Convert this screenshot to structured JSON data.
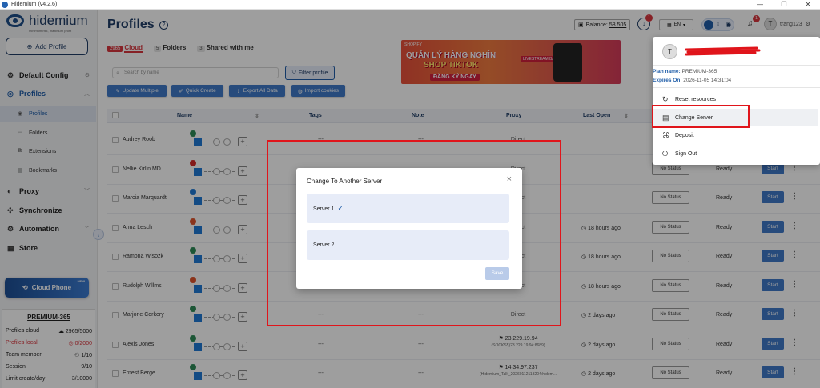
{
  "window": {
    "title": "Hidemium (v4.2.6)",
    "controls": [
      "—",
      "❐",
      "✕"
    ]
  },
  "sidebar": {
    "logo_name": "hidemium",
    "logo_tagline": "minimum risk, maximum profit",
    "add_profile_label": "Add Profile",
    "default_config_label": "Default Config",
    "profiles_label": "Profiles",
    "subitems": [
      {
        "label": "Profiles"
      },
      {
        "label": "Folders"
      },
      {
        "label": "Extensions"
      },
      {
        "label": "Bookmarks"
      }
    ],
    "proxy_label": "Proxy",
    "sync_label": "Synchronize",
    "automation_label": "Automation",
    "store_label": "Store",
    "cloud_phone_label": "Cloud Phone",
    "cloud_phone_badge": "NEW",
    "plan": {
      "title": "PREMIUM-365",
      "rows": [
        {
          "label": "Profiles cloud",
          "value": "2965/5000"
        },
        {
          "label": "Profiles local",
          "value": "0/2000"
        },
        {
          "label": "Team member",
          "value": "1/10"
        },
        {
          "label": "Session",
          "value": "9/10"
        },
        {
          "label": "Limit create/day",
          "value": "3/10000"
        }
      ]
    }
  },
  "header": {
    "title": "Profiles",
    "tabs": [
      {
        "count": "2965",
        "label": "Cloud"
      },
      {
        "count": "5",
        "label": "Folders"
      },
      {
        "count": "3",
        "label": "Shared with me"
      }
    ],
    "search_placeholder": "Search by name",
    "filter_label": "Filter profile",
    "actions": [
      "Update Multiple",
      "Quick Create",
      "Export All Data",
      "Import cookies"
    ],
    "balance_label": "Balance:",
    "balance_value": "58.505",
    "update_badge": "1",
    "lang": "EN",
    "notif_badge": "1",
    "user_name": "trang123",
    "avatar_letter": "T"
  },
  "banner": {
    "brand": "SHOPIFY",
    "line1": "QUẢN LÝ HÀNG NGHÌN",
    "line2": "SHOP TIKTOK",
    "cta": "ĐĂNG KÝ NGAY",
    "tag": "LIVESTREAM BÁN HÀNG"
  },
  "table": {
    "columns": [
      "Name",
      "Tags",
      "Note",
      "Proxy",
      "Last Open"
    ],
    "rows": [
      {
        "name": "Audrey Roob",
        "proxy": "Direct",
        "proxy_sub": "",
        "last_open": "",
        "status": "",
        "ready": "",
        "start": ""
      },
      {
        "name": "Nellie Kirlin MD",
        "proxy": "Direct",
        "proxy_sub": "",
        "last_open": "",
        "status": "No Status",
        "ready": "Ready",
        "start": "Start"
      },
      {
        "name": "Marcia Marquardt",
        "proxy": "Direct",
        "proxy_sub": "",
        "last_open": "",
        "status": "No Status",
        "ready": "Ready",
        "start": "Start"
      },
      {
        "name": "Anna Lesch",
        "proxy": "Direct",
        "proxy_sub": "",
        "last_open": "18 hours ago",
        "status": "No Status",
        "ready": "Ready",
        "start": "Start"
      },
      {
        "name": "Ramona Wisozk",
        "proxy": "Direct",
        "proxy_sub": "",
        "last_open": "18 hours ago",
        "status": "No Status",
        "ready": "Ready",
        "start": "Start"
      },
      {
        "name": "Rudolph Willms",
        "proxy": "Direct",
        "proxy_sub": "",
        "last_open": "18 hours ago",
        "status": "No Status",
        "ready": "Ready",
        "start": "Start"
      },
      {
        "name": "Marjorie Corkery",
        "proxy": "Direct",
        "proxy_sub": "",
        "last_open": "2 days ago",
        "status": "No Status",
        "ready": "Ready",
        "start": "Start"
      },
      {
        "name": "Alexis Jones",
        "proxy": "23.229.19.94",
        "proxy_sub": "(SOCKS5)23.229.19.94:8689)",
        "last_open": "2 days ago",
        "status": "No Status",
        "ready": "Ready",
        "start": "Start"
      },
      {
        "name": "Ernest Berge",
        "proxy": "14.34.97.237",
        "proxy_sub": "(Hidemium_Talk_20260112113204:hidem...",
        "last_open": "2 days ago",
        "status": "No Status",
        "ready": "Ready",
        "start": "Start"
      }
    ],
    "dots": "---"
  },
  "modal": {
    "title": "Change To Another Server",
    "servers": [
      {
        "label": "Server 1",
        "selected": true
      },
      {
        "label": "Server 2",
        "selected": false
      }
    ],
    "save_label": "Save"
  },
  "dropdown": {
    "avatar_letter": "T",
    "plan_label": "Plan name:",
    "plan_value": "PREMIUM-365",
    "expires_label": "Expires On:",
    "expires_value": "2026-11-05 14:31:04",
    "items": [
      "Reset resources",
      "Change Server",
      "Deposit",
      "Sign Out"
    ]
  }
}
